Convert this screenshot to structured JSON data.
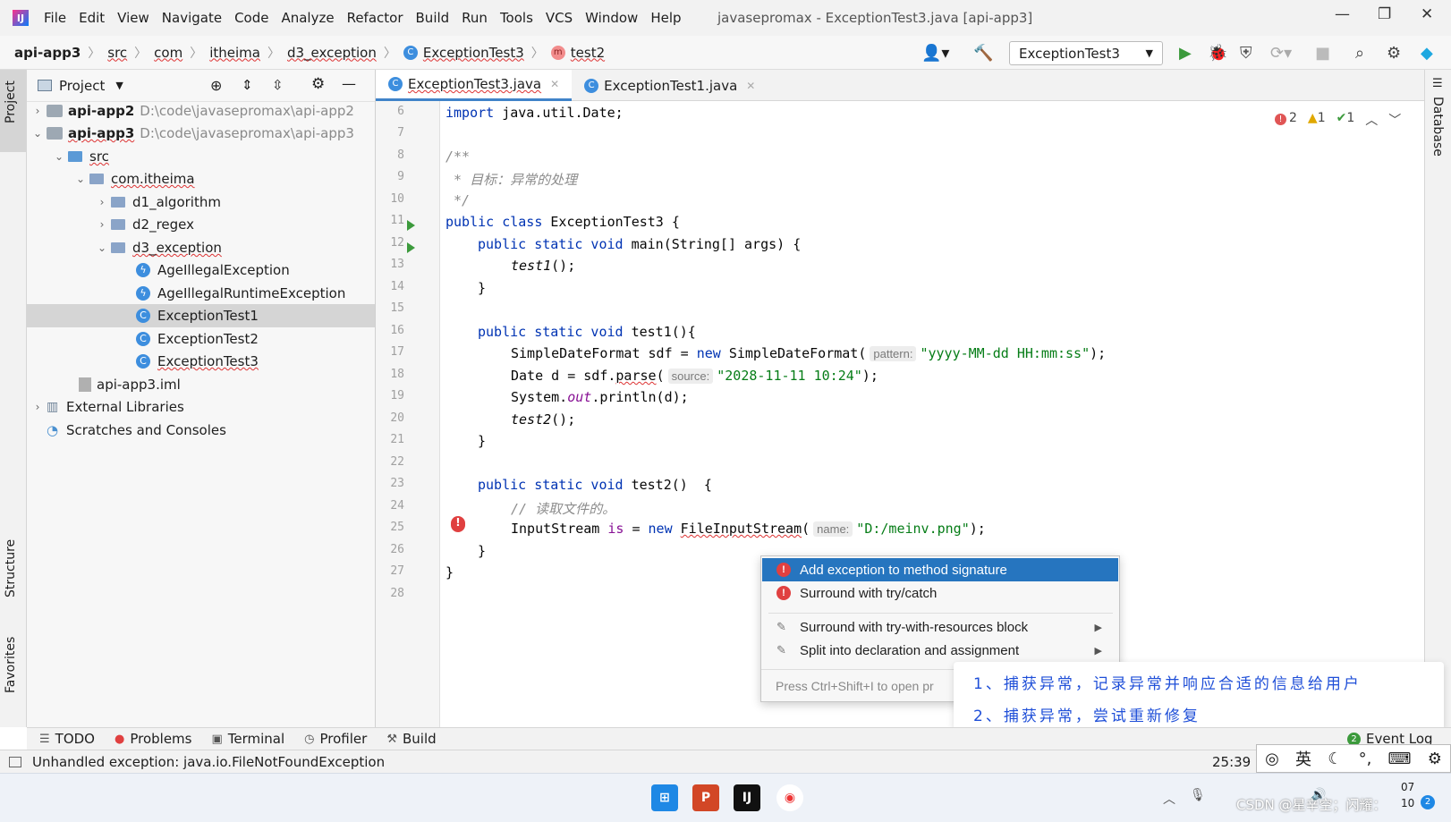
{
  "menubar": {
    "items": [
      "File",
      "Edit",
      "View",
      "Navigate",
      "Code",
      "Analyze",
      "Refactor",
      "Build",
      "Run",
      "Tools",
      "VCS",
      "Window",
      "Help"
    ],
    "title": "javasepromax - ExceptionTest3.java [api-app3]"
  },
  "breadcrumb": {
    "root": "api-app3",
    "items": [
      "src",
      "com",
      "itheima",
      "d3_exception",
      "ExceptionTest3",
      "test2"
    ]
  },
  "toolbar": {
    "run_config": "ExceptionTest3"
  },
  "left_strip": {
    "project": "Project",
    "structure": "Structure",
    "favorites": "Favorites"
  },
  "right_strip": {
    "database": "Database"
  },
  "project_panel": {
    "title": "Project",
    "rows": [
      {
        "label": "api-app2",
        "path": "D:\\code\\javasepromax\\api-app2"
      },
      {
        "label": "api-app3",
        "path": "D:\\code\\javasepromax\\api-app3"
      },
      {
        "label": "src"
      },
      {
        "label": "com.itheima"
      },
      {
        "label": "d1_algorithm"
      },
      {
        "label": "d2_regex"
      },
      {
        "label": "d3_exception"
      },
      {
        "label": "AgeIllegalException"
      },
      {
        "label": "AgeIllegalRuntimeException"
      },
      {
        "label": "ExceptionTest1"
      },
      {
        "label": "ExceptionTest2"
      },
      {
        "label": "ExceptionTest3"
      },
      {
        "label": "api-app3.iml"
      },
      {
        "label": "External Libraries"
      },
      {
        "label": "Scratches and Consoles"
      }
    ]
  },
  "editor_tabs": [
    {
      "label": "ExceptionTest3.java"
    },
    {
      "label": "ExceptionTest1.java"
    }
  ],
  "inspections": {
    "errors": "2",
    "warnings": "1",
    "weak": "1"
  },
  "code": {
    "line_numbers": [
      "6",
      "7",
      "8",
      "9",
      "10",
      "11",
      "12",
      "13",
      "14",
      "15",
      "16",
      "17",
      "18",
      "19",
      "20",
      "21",
      "22",
      "23",
      "24",
      "25",
      "26",
      "27",
      "28"
    ],
    "l6_kw": "import",
    "l6_rest": " java.util.Date;",
    "l8": "/**",
    "l9": " * 目标：异常的处理",
    "l10": " */",
    "l11_kw": "public class",
    "l11_rest": " ExceptionTest3 {",
    "l12_kw": "public static void",
    "l12_rest": " main(String[] args) {",
    "l13": "test1",
    "l13_rest": "();",
    "l14": "}",
    "l16_kw": "public static void",
    "l16_rest": " test1(){",
    "l17_a": "SimpleDateFormat sdf = ",
    "l17_kw": "new",
    "l17_b": " SimpleDateFormat(",
    "l17_hint": "pattern:",
    "l17_str": "\"yyyy-MM-dd HH:mm:ss\"",
    "l17_end": ");",
    "l18_a": "Date d = sdf.",
    "l18_m": "parse",
    "l18_b": "(",
    "l18_hint": "source:",
    "l18_str": "\"2028-11-11 10:24\"",
    "l18_end": ");",
    "l19_a": "System.",
    "l19_f": "out",
    "l19_b": ".println(d);",
    "l20": "test2",
    "l20_rest": "();",
    "l21": "}",
    "l23_kw": "public static void",
    "l23_rest": " test2()  {",
    "l24": "// 读取文件的。",
    "l25_a": "InputStream ",
    "l25_is": "is",
    "l25_b": " = ",
    "l25_kw": "new",
    "l25_cls": "FileInputStream",
    "l25_c": "(",
    "l25_hint": "name:",
    "l25_str": "\"D:/meinv.png\"",
    "l25_end": ");",
    "l26": "}",
    "l27": "}"
  },
  "popup": {
    "items": [
      "Add exception to method signature",
      "Surround with try/catch",
      "Surround with try-with-resources block",
      "Split into declaration and assignment"
    ],
    "footer": "Press Ctrl+Shift+I to open pr"
  },
  "overlay": {
    "line1": "1、捕获异常，记录异常并响应合适的信息给用户",
    "line2": "2、捕获异常，尝试重新修复"
  },
  "bottom_tools": [
    "TODO",
    "Problems",
    "Terminal",
    "Profiler",
    "Build"
  ],
  "event_log": {
    "count": "2",
    "label": "Event Log"
  },
  "status": {
    "message": "Unhandled exception: java.io.FileNotFoundException",
    "position": "25:39"
  },
  "ime": {
    "lang": "英"
  },
  "taskbar": {
    "time": "07",
    "date": "10",
    "badge": "2"
  },
  "watermark": "CSDN @星辛空；闪耀：",
  "colors": {
    "accent": "#2675bf",
    "keyword": "#0033b3",
    "string": "#067d17",
    "error": "#e04040"
  }
}
